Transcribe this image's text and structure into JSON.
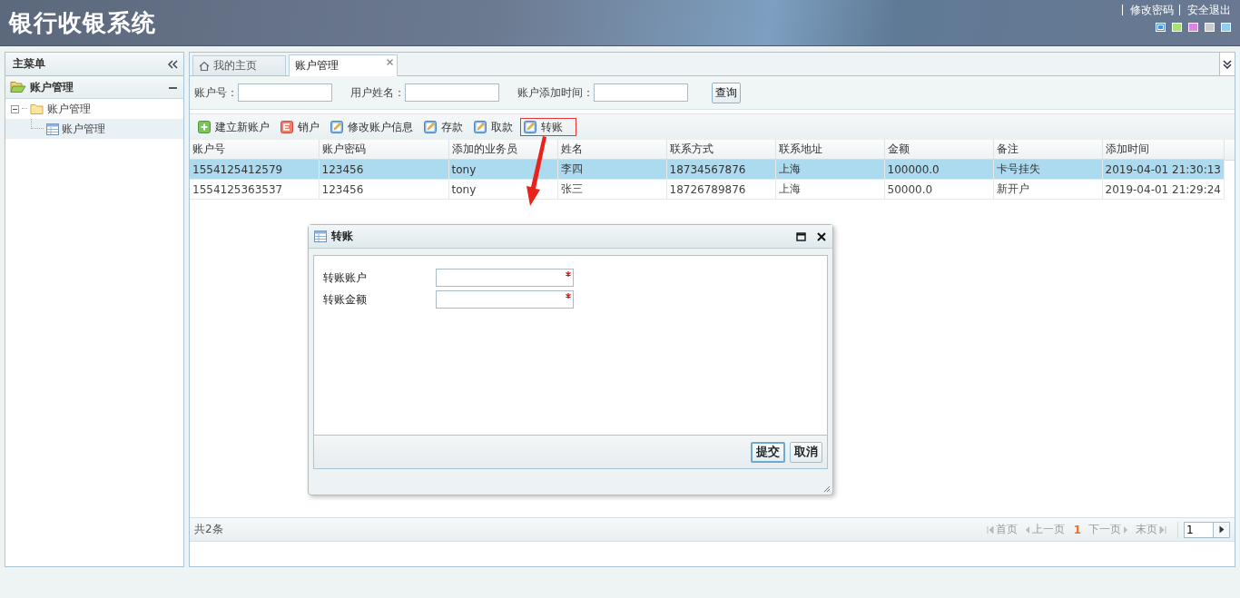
{
  "header": {
    "title": "银行收银系统",
    "links": [
      "修改密码",
      "安全退出"
    ],
    "themes": [
      {
        "color": "#4f8fd6",
        "selected": true
      },
      {
        "color": "#a9e075",
        "selected": false
      },
      {
        "color": "#e183e0",
        "selected": false
      },
      {
        "color": "#cbcbcb",
        "selected": false
      },
      {
        "color": "#8fcdf3",
        "selected": false
      }
    ]
  },
  "sidebar": {
    "title": "主菜单",
    "panel": {
      "title": "账户管理",
      "expanded": true
    },
    "tree": [
      {
        "label": "账户管理",
        "expanded": true,
        "children": [
          {
            "label": "账户管理",
            "selected": true
          }
        ]
      }
    ]
  },
  "tabs": [
    {
      "label": "我的主页",
      "selected": false,
      "closable": false
    },
    {
      "label": "账户管理",
      "selected": true,
      "closable": true
    }
  ],
  "search": {
    "fields": [
      {
        "label": "账户号："
      },
      {
        "label": "用户姓名："
      },
      {
        "label": "账户添加时间："
      }
    ],
    "button": "查询"
  },
  "toolbar": [
    {
      "label": "建立新账户",
      "kind": "add",
      "highlighted": false
    },
    {
      "label": "销户",
      "kind": "remove",
      "highlighted": false
    },
    {
      "label": "修改账户信息",
      "kind": "edit",
      "highlighted": false
    },
    {
      "label": "存款",
      "kind": "edit",
      "highlighted": false
    },
    {
      "label": "取款",
      "kind": "edit",
      "highlighted": false
    },
    {
      "label": "转账",
      "kind": "edit",
      "highlighted": true
    }
  ],
  "table": {
    "columns": [
      "账户号",
      "账户密码",
      "添加的业务员",
      "姓名",
      "联系方式",
      "联系地址",
      "金额",
      "备注",
      "添加时间"
    ],
    "rows": [
      {
        "cells": [
          "1554125412579",
          "123456",
          "tony",
          "李四",
          "18734567876",
          "上海",
          "100000.0",
          "卡号挂失",
          "2019-04-01 21:30:13"
        ],
        "selected": true
      },
      {
        "cells": [
          "1554125363537",
          "123456",
          "tony",
          "张三",
          "18726789876",
          "上海",
          "50000.0",
          "新开户",
          "2019-04-01 21:29:24"
        ],
        "selected": false
      }
    ]
  },
  "dialog": {
    "title": "转账",
    "fields": [
      {
        "label": "转账账户",
        "required": true
      },
      {
        "label": "转账金额",
        "required": true
      }
    ],
    "buttons": [
      {
        "label": "提交",
        "focused": true
      },
      {
        "label": "取消",
        "focused": false
      }
    ]
  },
  "pager": {
    "total": "共2条",
    "first": "首页",
    "prev": "上一页",
    "current": "1",
    "next": "下一页",
    "last": "末页",
    "page_value": "1"
  }
}
